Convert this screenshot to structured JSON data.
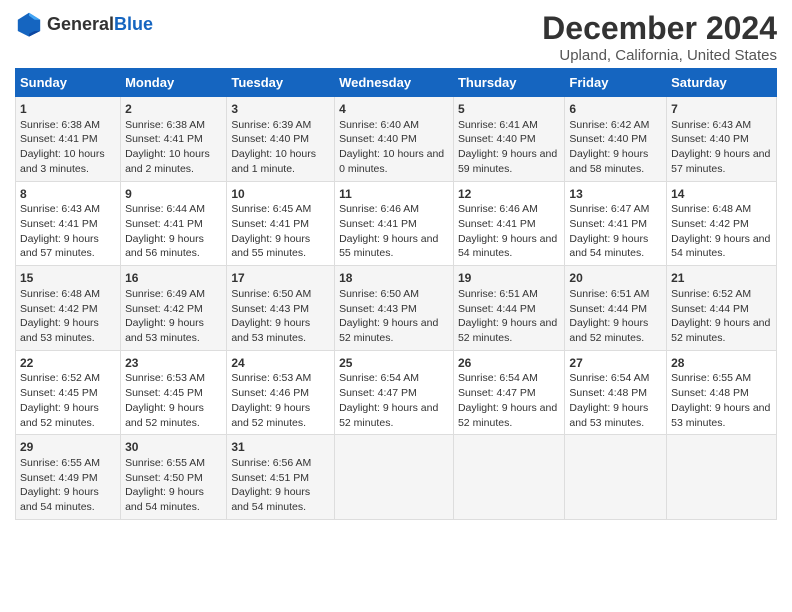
{
  "header": {
    "logo_general": "General",
    "logo_blue": "Blue",
    "title": "December 2024",
    "subtitle": "Upland, California, United States"
  },
  "days_of_week": [
    "Sunday",
    "Monday",
    "Tuesday",
    "Wednesday",
    "Thursday",
    "Friday",
    "Saturday"
  ],
  "weeks": [
    [
      {
        "day": "1",
        "sunrise": "Sunrise: 6:38 AM",
        "sunset": "Sunset: 4:41 PM",
        "daylight": "Daylight: 10 hours and 3 minutes."
      },
      {
        "day": "2",
        "sunrise": "Sunrise: 6:38 AM",
        "sunset": "Sunset: 4:41 PM",
        "daylight": "Daylight: 10 hours and 2 minutes."
      },
      {
        "day": "3",
        "sunrise": "Sunrise: 6:39 AM",
        "sunset": "Sunset: 4:40 PM",
        "daylight": "Daylight: 10 hours and 1 minute."
      },
      {
        "day": "4",
        "sunrise": "Sunrise: 6:40 AM",
        "sunset": "Sunset: 4:40 PM",
        "daylight": "Daylight: 10 hours and 0 minutes."
      },
      {
        "day": "5",
        "sunrise": "Sunrise: 6:41 AM",
        "sunset": "Sunset: 4:40 PM",
        "daylight": "Daylight: 9 hours and 59 minutes."
      },
      {
        "day": "6",
        "sunrise": "Sunrise: 6:42 AM",
        "sunset": "Sunset: 4:40 PM",
        "daylight": "Daylight: 9 hours and 58 minutes."
      },
      {
        "day": "7",
        "sunrise": "Sunrise: 6:43 AM",
        "sunset": "Sunset: 4:40 PM",
        "daylight": "Daylight: 9 hours and 57 minutes."
      }
    ],
    [
      {
        "day": "8",
        "sunrise": "Sunrise: 6:43 AM",
        "sunset": "Sunset: 4:41 PM",
        "daylight": "Daylight: 9 hours and 57 minutes."
      },
      {
        "day": "9",
        "sunrise": "Sunrise: 6:44 AM",
        "sunset": "Sunset: 4:41 PM",
        "daylight": "Daylight: 9 hours and 56 minutes."
      },
      {
        "day": "10",
        "sunrise": "Sunrise: 6:45 AM",
        "sunset": "Sunset: 4:41 PM",
        "daylight": "Daylight: 9 hours and 55 minutes."
      },
      {
        "day": "11",
        "sunrise": "Sunrise: 6:46 AM",
        "sunset": "Sunset: 4:41 PM",
        "daylight": "Daylight: 9 hours and 55 minutes."
      },
      {
        "day": "12",
        "sunrise": "Sunrise: 6:46 AM",
        "sunset": "Sunset: 4:41 PM",
        "daylight": "Daylight: 9 hours and 54 minutes."
      },
      {
        "day": "13",
        "sunrise": "Sunrise: 6:47 AM",
        "sunset": "Sunset: 4:41 PM",
        "daylight": "Daylight: 9 hours and 54 minutes."
      },
      {
        "day": "14",
        "sunrise": "Sunrise: 6:48 AM",
        "sunset": "Sunset: 4:42 PM",
        "daylight": "Daylight: 9 hours and 54 minutes."
      }
    ],
    [
      {
        "day": "15",
        "sunrise": "Sunrise: 6:48 AM",
        "sunset": "Sunset: 4:42 PM",
        "daylight": "Daylight: 9 hours and 53 minutes."
      },
      {
        "day": "16",
        "sunrise": "Sunrise: 6:49 AM",
        "sunset": "Sunset: 4:42 PM",
        "daylight": "Daylight: 9 hours and 53 minutes."
      },
      {
        "day": "17",
        "sunrise": "Sunrise: 6:50 AM",
        "sunset": "Sunset: 4:43 PM",
        "daylight": "Daylight: 9 hours and 53 minutes."
      },
      {
        "day": "18",
        "sunrise": "Sunrise: 6:50 AM",
        "sunset": "Sunset: 4:43 PM",
        "daylight": "Daylight: 9 hours and 52 minutes."
      },
      {
        "day": "19",
        "sunrise": "Sunrise: 6:51 AM",
        "sunset": "Sunset: 4:44 PM",
        "daylight": "Daylight: 9 hours and 52 minutes."
      },
      {
        "day": "20",
        "sunrise": "Sunrise: 6:51 AM",
        "sunset": "Sunset: 4:44 PM",
        "daylight": "Daylight: 9 hours and 52 minutes."
      },
      {
        "day": "21",
        "sunrise": "Sunrise: 6:52 AM",
        "sunset": "Sunset: 4:44 PM",
        "daylight": "Daylight: 9 hours and 52 minutes."
      }
    ],
    [
      {
        "day": "22",
        "sunrise": "Sunrise: 6:52 AM",
        "sunset": "Sunset: 4:45 PM",
        "daylight": "Daylight: 9 hours and 52 minutes."
      },
      {
        "day": "23",
        "sunrise": "Sunrise: 6:53 AM",
        "sunset": "Sunset: 4:45 PM",
        "daylight": "Daylight: 9 hours and 52 minutes."
      },
      {
        "day": "24",
        "sunrise": "Sunrise: 6:53 AM",
        "sunset": "Sunset: 4:46 PM",
        "daylight": "Daylight: 9 hours and 52 minutes."
      },
      {
        "day": "25",
        "sunrise": "Sunrise: 6:54 AM",
        "sunset": "Sunset: 4:47 PM",
        "daylight": "Daylight: 9 hours and 52 minutes."
      },
      {
        "day": "26",
        "sunrise": "Sunrise: 6:54 AM",
        "sunset": "Sunset: 4:47 PM",
        "daylight": "Daylight: 9 hours and 52 minutes."
      },
      {
        "day": "27",
        "sunrise": "Sunrise: 6:54 AM",
        "sunset": "Sunset: 4:48 PM",
        "daylight": "Daylight: 9 hours and 53 minutes."
      },
      {
        "day": "28",
        "sunrise": "Sunrise: 6:55 AM",
        "sunset": "Sunset: 4:48 PM",
        "daylight": "Daylight: 9 hours and 53 minutes."
      }
    ],
    [
      {
        "day": "29",
        "sunrise": "Sunrise: 6:55 AM",
        "sunset": "Sunset: 4:49 PM",
        "daylight": "Daylight: 9 hours and 54 minutes."
      },
      {
        "day": "30",
        "sunrise": "Sunrise: 6:55 AM",
        "sunset": "Sunset: 4:50 PM",
        "daylight": "Daylight: 9 hours and 54 minutes."
      },
      {
        "day": "31",
        "sunrise": "Sunrise: 6:56 AM",
        "sunset": "Sunset: 4:51 PM",
        "daylight": "Daylight: 9 hours and 54 minutes."
      },
      null,
      null,
      null,
      null
    ]
  ]
}
